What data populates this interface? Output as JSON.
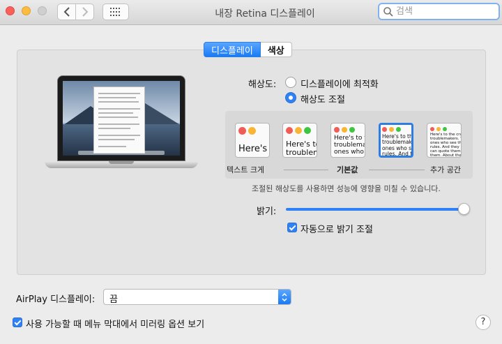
{
  "window": {
    "title": "내장 Retina 디스플레이"
  },
  "search": {
    "placeholder": "검색"
  },
  "tabs": [
    {
      "label": "디스플레이",
      "active": true
    },
    {
      "label": "색상",
      "active": false
    }
  ],
  "resolution": {
    "label": "해상도:",
    "options": [
      {
        "label": "디스플레이에 최적화",
        "selected": false
      },
      {
        "label": "해상도 조절",
        "selected": true
      }
    ],
    "thumbnails": [
      {
        "text": "Here's"
      },
      {
        "text": "Here's to\ntroublem"
      },
      {
        "text": "Here's to th\ntroublemak\nones who se"
      },
      {
        "text": "Here's to the cr\ntroublemakers.\nones who see th\nrules. And they",
        "selected": true
      },
      {
        "text": "Here's to the crazy one\ntroublemakers. The rou\nones who see things di\nrules. And they have n\ncan quote them, disagr\nthem. About the only th\nBecause they change t"
      }
    ],
    "scale_labels": {
      "left": "텍스트 크게",
      "middle": "기본값",
      "right": "추가 공간"
    },
    "note": "조절된 해상도를 사용하면 성능에 영향을 미칠 수 있습니다."
  },
  "brightness": {
    "label": "밝기:",
    "level_percent": 100,
    "auto_label": "자동으로 밝기 조절",
    "auto_checked": true
  },
  "airplay": {
    "label": "AirPlay 디스플레이:",
    "value": "끔"
  },
  "mirroring": {
    "label": "사용 가능할 때 메뉴 막대에서 미러링 옵션 보기",
    "checked": true
  },
  "help": {
    "label": "?"
  },
  "colors": {
    "accent": "#2f82f5"
  }
}
